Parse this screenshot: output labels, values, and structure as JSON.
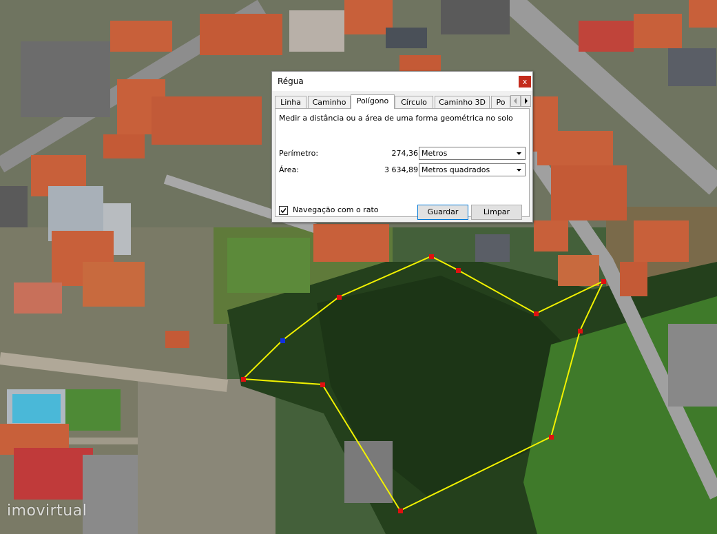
{
  "dialog": {
    "title": "Régua",
    "close_symbol": "x",
    "tabs": [
      {
        "label": "Linha"
      },
      {
        "label": "Caminho"
      },
      {
        "label": "Polígono"
      },
      {
        "label": "Círculo"
      },
      {
        "label": "Caminho 3D"
      },
      {
        "label": "Po"
      }
    ],
    "active_tab": "Polígono",
    "description": "Medir a distância ou a área de uma forma geométrica no solo",
    "perimeter": {
      "label": "Perímetro:",
      "value": "274,36",
      "unit": "Metros"
    },
    "area": {
      "label": "Área:",
      "value": "3 634,89",
      "unit": "Metros quadrados"
    },
    "mouse_navigation": {
      "label": "Navegação com o rato",
      "checked": true
    },
    "save_label": "Guardar",
    "clear_label": "Limpar"
  },
  "watermark": "imovirtual",
  "colors": {
    "polygon_line": "#f2f200",
    "vertex": "#e01010",
    "vertex_selected": "#1030e0",
    "close": "#c42b1c",
    "tab_border": "#acacac"
  }
}
